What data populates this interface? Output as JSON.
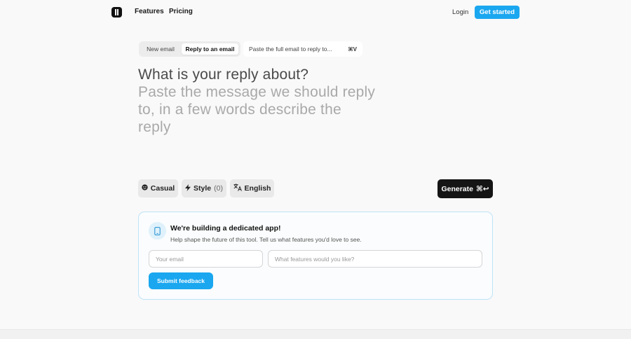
{
  "header": {
    "nav": {
      "features": "Features",
      "pricing": "Pricing"
    },
    "login": "Login",
    "get_started": "Get started"
  },
  "mode": {
    "new_email": "New email",
    "reply": "Reply to an email",
    "selected": "Reply to an email"
  },
  "paste_hint": {
    "label": "Paste the full email to reply to...",
    "shortcut": "⌘V"
  },
  "prompt": {
    "question": "What is your reply about?",
    "placeholder": "Paste the message we should reply to, in a few words describe the reply"
  },
  "options": {
    "tone": {
      "icon": "smiley-icon",
      "label": "Casual"
    },
    "style": {
      "icon": "bolt-icon",
      "label": "Style",
      "count": "(0)"
    },
    "language": {
      "icon": "translate-icon",
      "label": "English"
    }
  },
  "generate": {
    "label": "Generate",
    "shortcut": "⌘↩"
  },
  "feedback": {
    "icon": "phone-icon",
    "title": "We're building a dedicated app!",
    "subtitle": "Help shape the future of this tool. Tell us what features you'd love to see.",
    "email_placeholder": "Your email",
    "features_placeholder": "What features would you like?",
    "submit": "Submit feedback"
  },
  "colors": {
    "accent": "#1aa7f0",
    "dark_button": "#151515",
    "card_border": "#bfe3f8"
  }
}
